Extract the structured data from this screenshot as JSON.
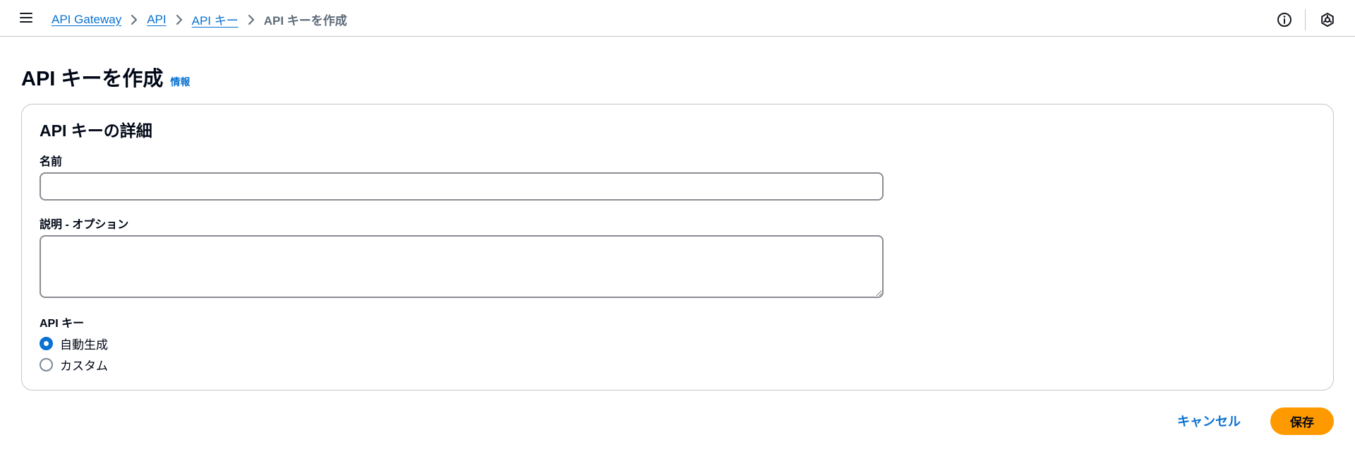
{
  "breadcrumb": {
    "items": [
      "API Gateway",
      "API",
      "API キー"
    ],
    "current": "API キーを作成"
  },
  "page": {
    "title": "API キーを作成",
    "info_link": "情報"
  },
  "form": {
    "section_title": "API キーの詳細",
    "name_label": "名前",
    "name_value": "",
    "description_label": "説明 - オプション",
    "description_value": "",
    "api_key_label": "API キー",
    "api_key_options": [
      {
        "label": "自動生成",
        "checked": true
      },
      {
        "label": "カスタム",
        "checked": false
      }
    ]
  },
  "actions": {
    "cancel_label": "キャンセル",
    "save_label": "保存"
  },
  "icons": {
    "menu": "menu-icon",
    "chevron": "chevron-right-icon",
    "info": "info-icon",
    "settings": "hexagon-settings-icon"
  },
  "colors": {
    "link": "#0972d3",
    "primary_button": "#ff9900",
    "border": "#c6c6cd"
  }
}
